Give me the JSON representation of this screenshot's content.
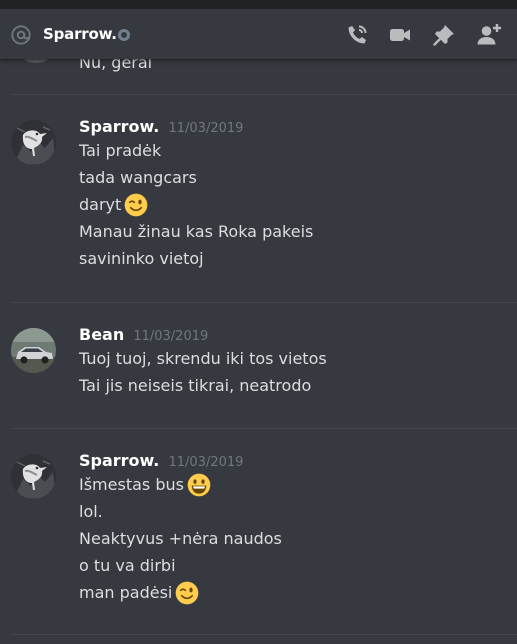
{
  "header": {
    "channel_name": "Sparrow.",
    "status": "offline"
  },
  "colors": {
    "background": "#36393f",
    "header_icon": "#b9bbbe",
    "username": "#ffffff",
    "timestamp": "#72767d",
    "message_text": "#dcddde",
    "emoji": "#ffcc4d"
  },
  "messages": {
    "previous_line": "Nu, gerai",
    "groups": [
      {
        "username": "Sparrow.",
        "timestamp": "11/03/2019",
        "avatar": "sparrow-bird",
        "lines": [
          {
            "text": "Tai pradėk"
          },
          {
            "text": "tada wangcars"
          },
          {
            "text": "daryt",
            "emoji": "winking-face"
          },
          {
            "text": "Manau žinau kas Roka pakeis"
          },
          {
            "text": "savininko vietoj"
          }
        ]
      },
      {
        "username": "Bean",
        "timestamp": "11/03/2019",
        "avatar": "silver-car",
        "lines": [
          {
            "text": "Tuoj tuoj, skrendu iki tos vietos"
          },
          {
            "text": "Tai jis neiseis tikrai, neatrodo"
          }
        ]
      },
      {
        "username": "Sparrow.",
        "timestamp": "11/03/2019",
        "avatar": "sparrow-bird",
        "lines": [
          {
            "text": "Išmestas bus",
            "emoji": "grinning-face"
          },
          {
            "text": "lol."
          },
          {
            "text": "Neaktyvus +nėra naudos"
          },
          {
            "text": "o tu va dirbi"
          },
          {
            "text": "man padėsi",
            "emoji": "winking-face"
          }
        ]
      }
    ]
  }
}
